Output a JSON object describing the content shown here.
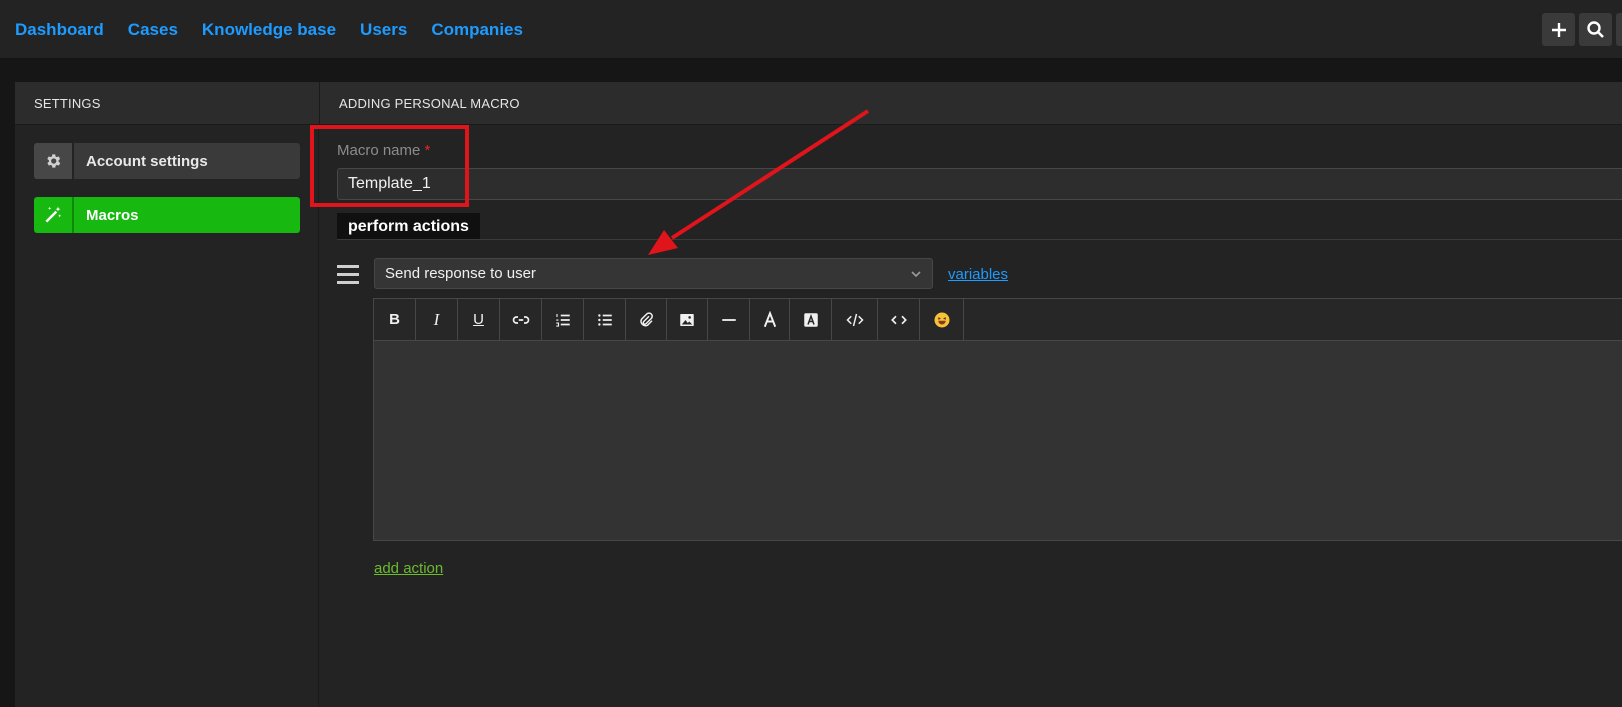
{
  "nav": {
    "items": [
      "Dashboard",
      "Cases",
      "Knowledge base",
      "Users",
      "Companies"
    ]
  },
  "top_actions": {
    "icons": [
      "plus-icon",
      "search-icon"
    ]
  },
  "settings": {
    "header": "SETTINGS",
    "items": [
      {
        "label": "Account settings",
        "icon": "gear-icon"
      },
      {
        "label": "Macros",
        "icon": "magic-wand-icon"
      }
    ]
  },
  "macro": {
    "header": "ADDING PERSONAL MACRO",
    "name_label": "Macro name",
    "required_mark": "*",
    "name_value": "Template_1",
    "section_label": "perform actions",
    "action_select": "Send response to user",
    "variables_link": "variables",
    "add_action_link": "add action"
  },
  "editor_toolbar": {
    "bold": "B",
    "italic": "I",
    "underline": "U",
    "buttons": [
      "bold",
      "italic",
      "underline",
      "link",
      "ordered-list",
      "bullet-list",
      "attachment",
      "image",
      "horizontal-rule",
      "text-color",
      "background-color",
      "code-view",
      "code-inline",
      "emoji"
    ]
  },
  "colors": {
    "link": "#1e9bff",
    "active": "#17b80f",
    "annotation": "#e0141b",
    "add_action": "#6bbb2f"
  }
}
